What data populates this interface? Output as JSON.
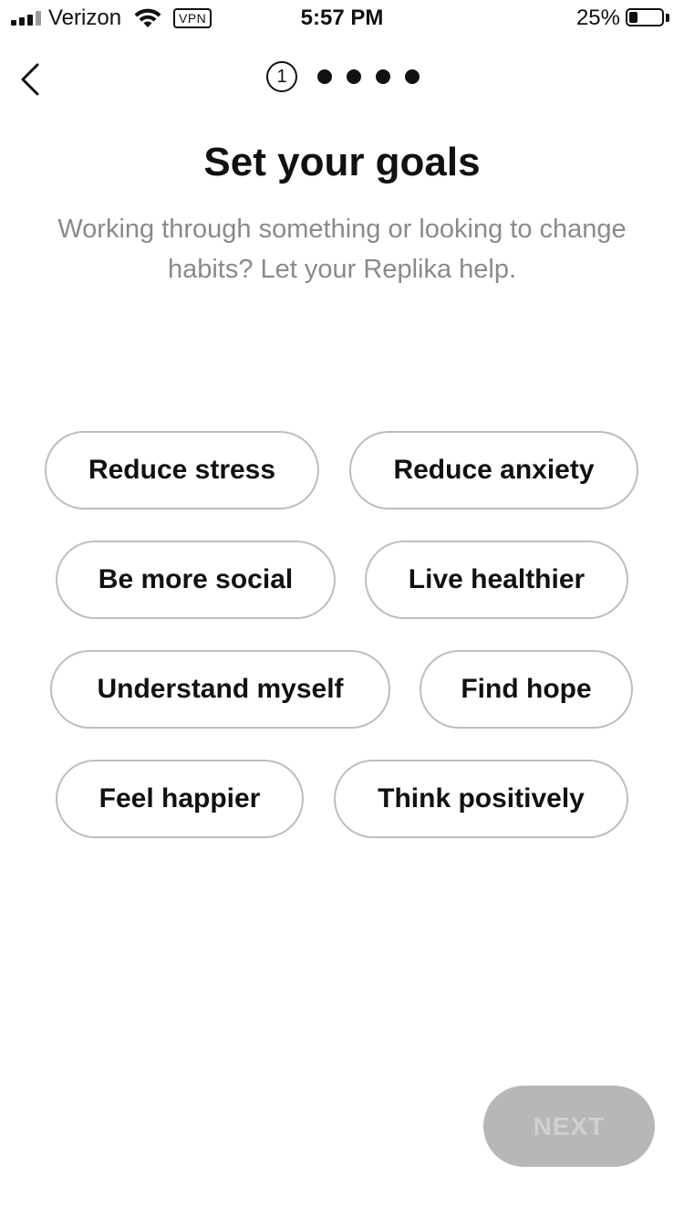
{
  "status_bar": {
    "carrier": "Verizon",
    "vpn": "VPN",
    "time": "5:57 PM",
    "battery": "25%",
    "battery_level": 0.25
  },
  "nav": {
    "back_icon": "chevron-left-icon",
    "current_step": "1",
    "total_steps": 5
  },
  "header": {
    "title": "Set your goals",
    "subtitle": "Working through something or looking to change habits? Let your Replika help."
  },
  "goals": [
    "Reduce stress",
    "Reduce anxiety",
    "Be more social",
    "Live healthier",
    "Understand myself",
    "Find hope",
    "Feel happier",
    "Think positively"
  ],
  "footer": {
    "next_label": "NEXT",
    "next_enabled": false
  },
  "colors": {
    "text": "#111111",
    "subtitle": "#8a8a8a",
    "chip_border": "#bdbdbd",
    "next_bg_disabled": "#b7b7b7",
    "next_text_disabled": "#cfcfcf"
  }
}
